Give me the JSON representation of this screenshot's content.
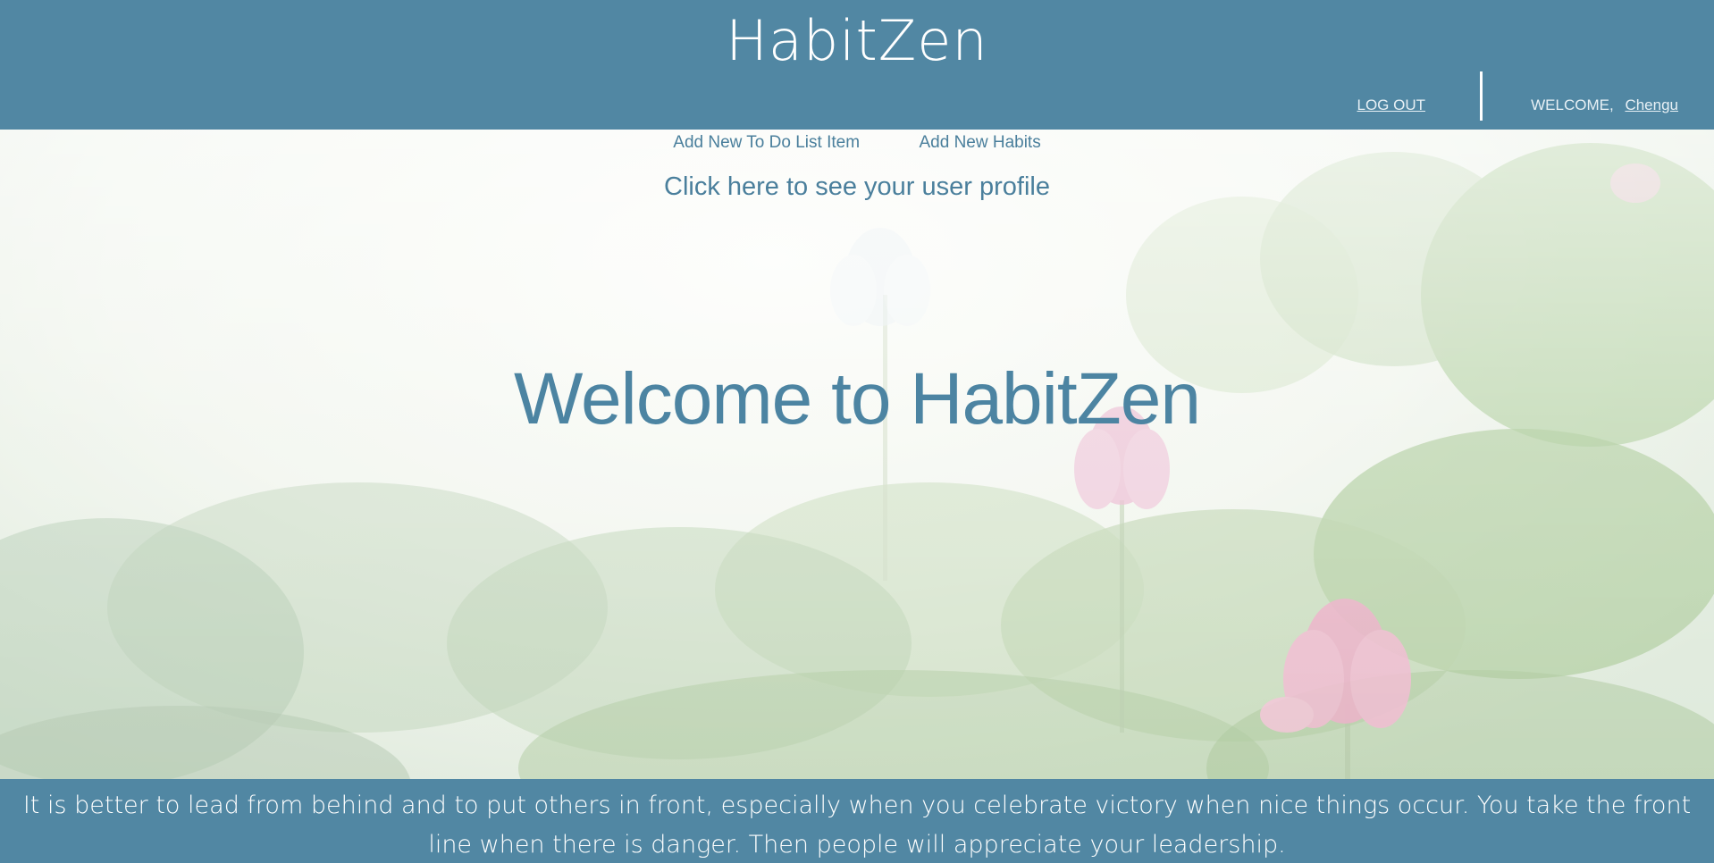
{
  "header": {
    "brand": "HabitZen",
    "logout_label": "LOG OUT",
    "welcome_label": "WELCOME,",
    "username": "Chengu"
  },
  "nav": {
    "add_todo_label": "Add New To Do List Item",
    "add_habits_label": "Add New Habits",
    "profile_link_label": "Click here to see your user profile"
  },
  "hero": {
    "title": "Welcome to HabitZen"
  },
  "footer": {
    "quote": "It is better to lead from behind and to put others in front, especially when you celebrate victory when nice things occur. You take the front line when there is danger. Then people will appreciate your leadership."
  },
  "theme": {
    "bar_color": "#5187a3",
    "link_color": "#4a7f9c",
    "background_image": "lotus-pond"
  }
}
